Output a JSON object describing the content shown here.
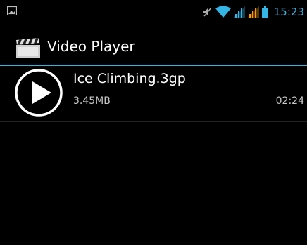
{
  "status_bar": {
    "time": "15:23",
    "notification_icon": "image-icon",
    "icons": [
      "mute-icon",
      "wifi-icon",
      "signal-icon",
      "signal-alt-icon",
      "battery-icon"
    ],
    "accent_color": "#33b5e5",
    "alt_signal_color": "#ff9900"
  },
  "action_bar": {
    "title": "Video Player",
    "icon": "clapperboard-icon",
    "divider_color": "#33b5e5"
  },
  "videos": [
    {
      "name": "Ice Climbing.3gp",
      "size": "3.45MB",
      "duration": "02:24",
      "icon": "play-icon"
    }
  ]
}
